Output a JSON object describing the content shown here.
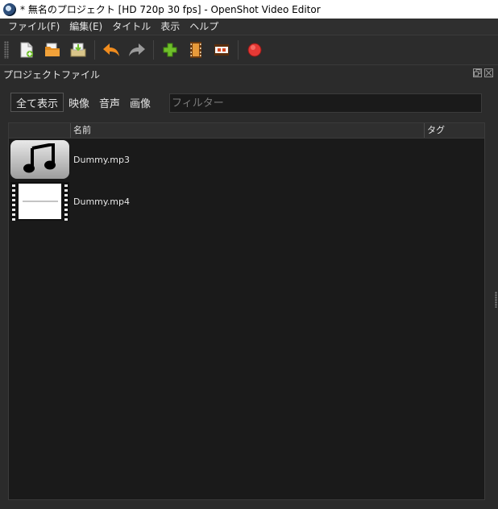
{
  "window": {
    "title": "* 無名のプロジェクト [HD 720p 30 fps] - OpenShot Video Editor"
  },
  "menu": [
    "ファイル(F)",
    "編集(E)",
    "タイトル",
    "表示",
    "ヘルプ"
  ],
  "toolbar": {
    "buttons": [
      {
        "name": "new-project-icon"
      },
      {
        "name": "open-project-icon"
      },
      {
        "name": "save-project-icon"
      },
      {
        "name": "undo-icon"
      },
      {
        "name": "redo-icon"
      },
      {
        "name": "import-files-icon"
      },
      {
        "name": "choose-profile-icon"
      },
      {
        "name": "fullscreen-icon"
      },
      {
        "name": "export-video-icon"
      }
    ]
  },
  "dock": {
    "title": "プロジェクトファイル"
  },
  "filters": {
    "tabs": [
      "全て表示",
      "映像",
      "音声",
      "画像"
    ],
    "active": "全て表示",
    "search_placeholder": "フィルター",
    "search_value": ""
  },
  "table": {
    "columns": [
      "",
      "名前",
      "タグ"
    ],
    "rows": [
      {
        "name": "Dummy.mp3",
        "type": "audio",
        "tags": ""
      },
      {
        "name": "Dummy.mp4",
        "type": "video",
        "tags": ""
      }
    ]
  },
  "colors": {
    "background": "#2b2b2b",
    "list_background": "#1a1a1a",
    "text": "#e6e6e6",
    "accent_green": "#6fbf2a",
    "record_red": "#e53935"
  }
}
